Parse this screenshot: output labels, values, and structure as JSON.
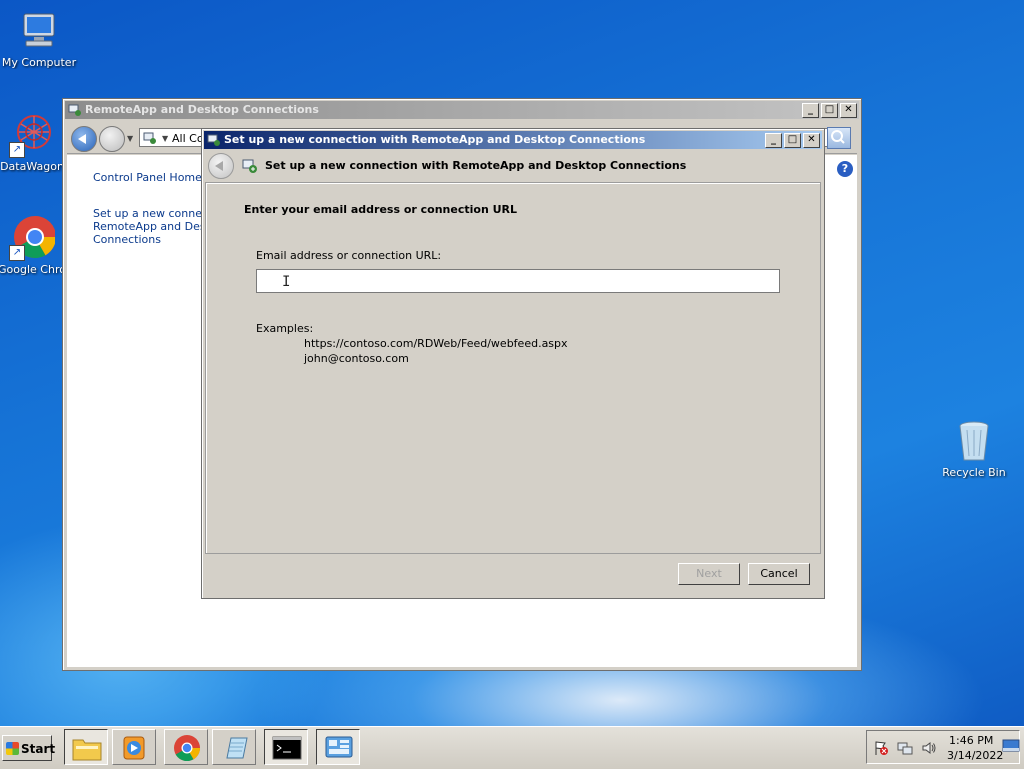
{
  "desktop": {
    "icons": [
      {
        "label": "My Computer"
      },
      {
        "label": "DataWagon"
      },
      {
        "label": "Google Chro"
      },
      {
        "label": "Recycle Bin"
      }
    ]
  },
  "control_panel": {
    "title": "RemoteApp and Desktop Connections",
    "address_text": "All Co",
    "sidebar": {
      "home_link": "Control Panel Home",
      "setup_link_line1": "Set up a new connectio",
      "setup_link_line2": "RemoteApp and Deskto",
      "setup_link_line3": "Connections"
    }
  },
  "dialog": {
    "title": "Set up a new connection with RemoteApp and Desktop Connections",
    "header_title": "Set up a new connection with RemoteApp and Desktop Connections",
    "instruction": "Enter your email address or connection URL",
    "field_label": "Email address or connection URL:",
    "field_value": "",
    "examples_label": "Examples:",
    "examples": [
      "https://contoso.com/RDWeb/Feed/webfeed.aspx",
      "john@contoso.com"
    ],
    "next_label": "Next",
    "cancel_label": "Cancel"
  },
  "titlebar_buttons": {
    "minimize": "_",
    "maximize": "□",
    "close": "✕"
  },
  "taskbar": {
    "start_label": "Start",
    "time": "1:46 PM",
    "date": "3/14/2022"
  },
  "icons": {
    "back": "back-arrow-icon",
    "forward": "forward-arrow-icon",
    "help": "?",
    "cursor": "I"
  }
}
